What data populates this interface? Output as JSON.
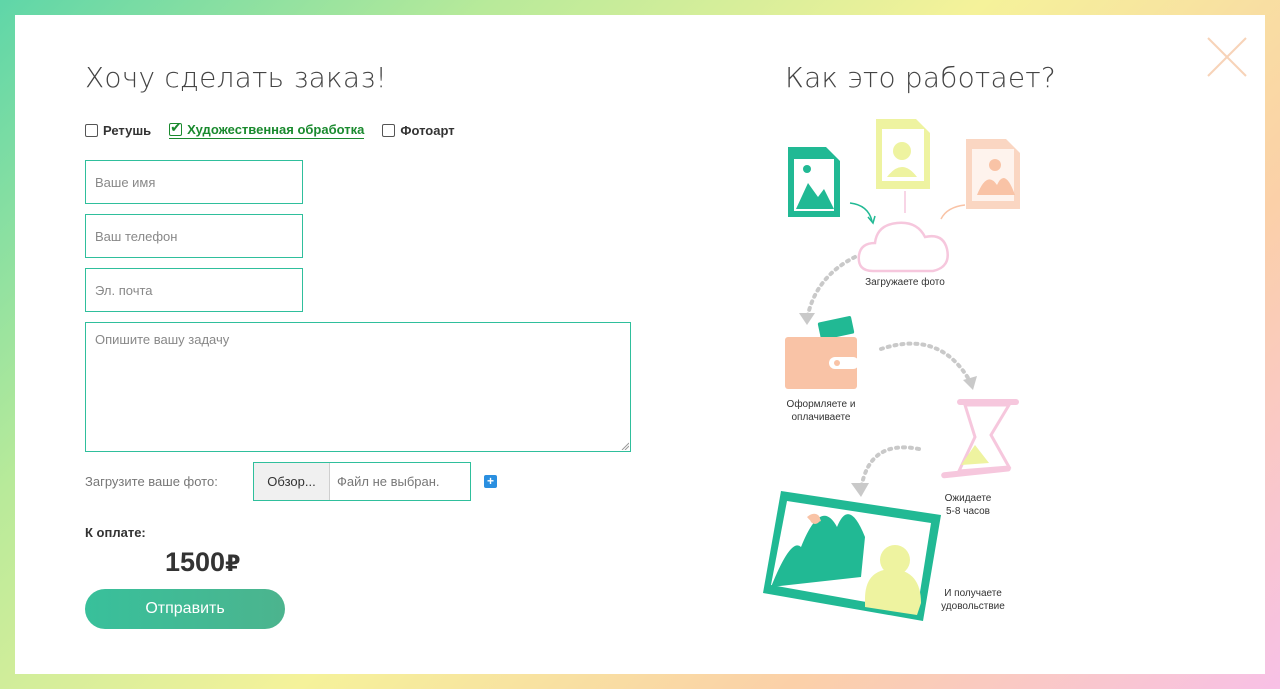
{
  "form": {
    "title": "Хочу сделать заказ!",
    "options": [
      {
        "label": "Ретушь",
        "checked": false
      },
      {
        "label": "Художественная обработка",
        "checked": true
      },
      {
        "label": "Фотоарт",
        "checked": false
      }
    ],
    "name_placeholder": "Ваше имя",
    "phone_placeholder": "Ваш телефон",
    "email_placeholder": "Эл. почта",
    "task_placeholder": "Опишите вашу задачу",
    "upload_label": "Загрузите ваше фото:",
    "file_button": "Обзор...",
    "file_status": "Файл не выбран.",
    "add_file": "+",
    "pay_label": "К оплате:",
    "price": "1500",
    "currency": "₽",
    "submit_label": "Отправить"
  },
  "how": {
    "title": "Как это работает?",
    "steps": [
      {
        "caption": "Загружаете фото"
      },
      {
        "caption_line1": "Оформляете и",
        "caption_line2": "оплачиваете"
      },
      {
        "caption_line1": "Ожидаете",
        "caption_line2": "5-8 часов"
      },
      {
        "caption_line1": "И получаете",
        "caption_line2": "удовольствие"
      }
    ]
  },
  "colors": {
    "accent": "#2fbf9c",
    "active_option": "#1a8a2e",
    "peach": "#f9c3a6",
    "yellow": "#eef3a0",
    "pink": "#f6c7dd"
  }
}
